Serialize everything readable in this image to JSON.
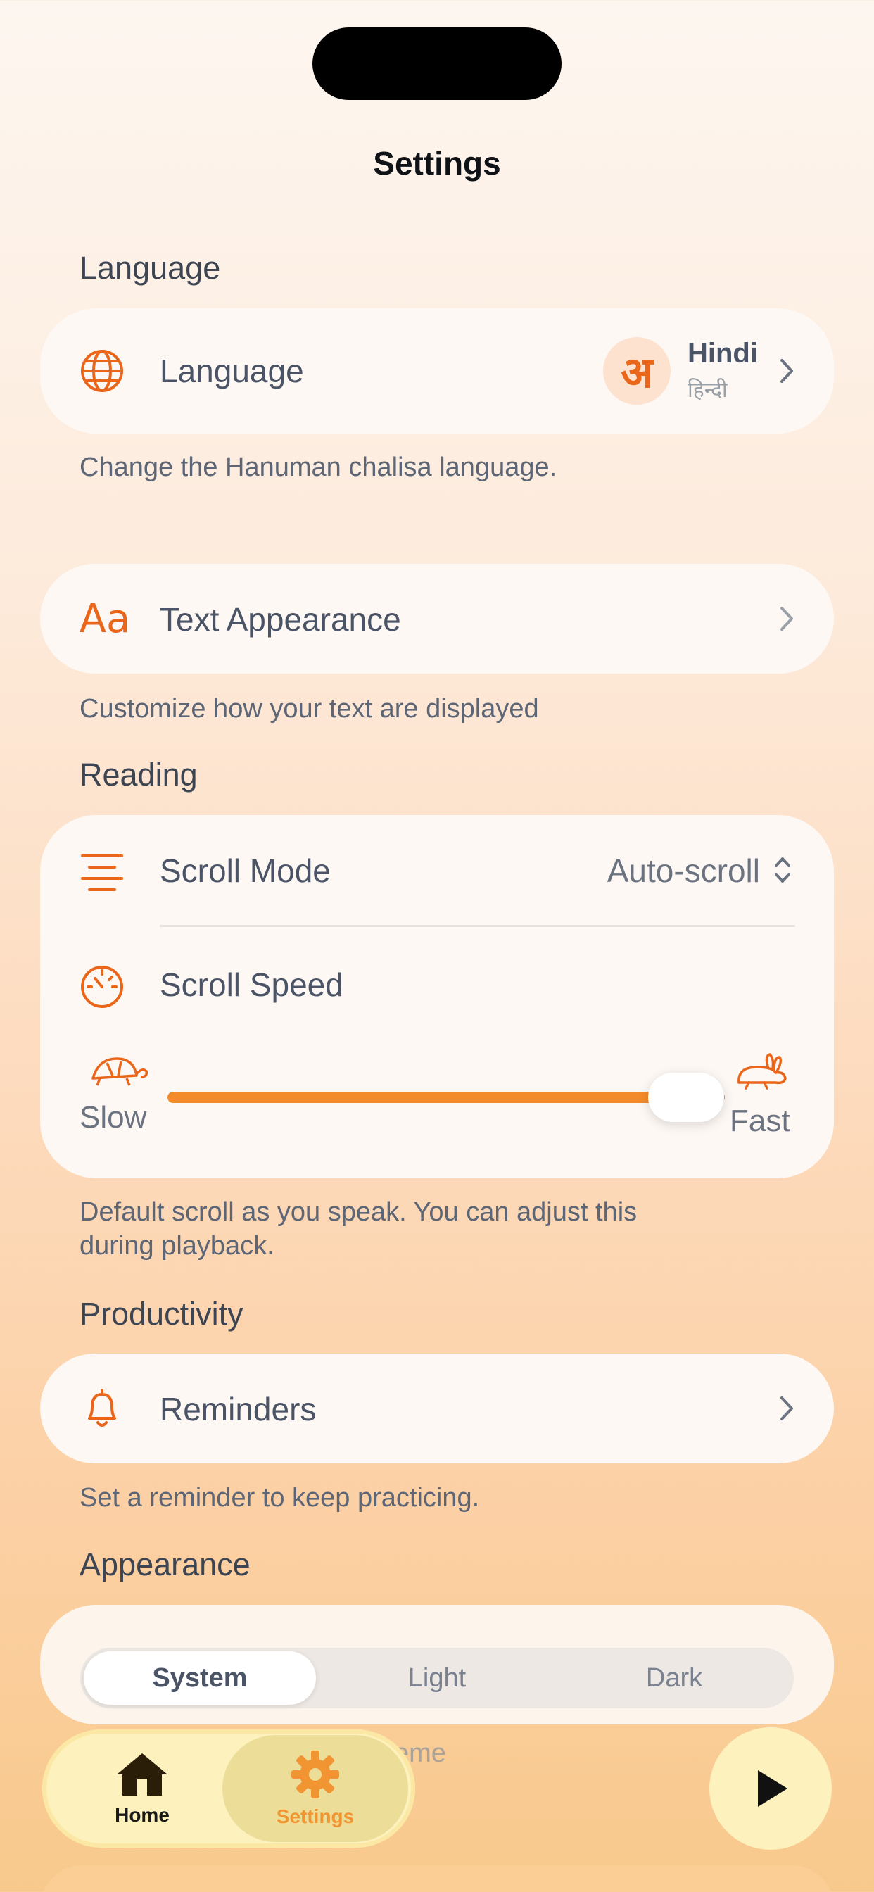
{
  "page": {
    "title": "Settings"
  },
  "language_section": {
    "heading": "Language",
    "row_label": "Language",
    "badge_glyph": "अ",
    "selected_language": "Hindi",
    "selected_native": "हिन्दी",
    "hint": "Change the Hanuman chalisa language."
  },
  "text_appearance": {
    "icon_text": "Aa",
    "row_label": "Text Appearance",
    "hint": "Customize how your text are displayed"
  },
  "reading_section": {
    "heading": "Reading",
    "scroll_mode_label": "Scroll Mode",
    "scroll_mode_value": "Auto-scroll",
    "scroll_speed_label": "Scroll Speed",
    "slow_label": "Slow",
    "fast_label": "Fast",
    "speed_value_fraction": 0.93,
    "hint_line1": "Default scroll as you speak. You can adjust this",
    "hint_line2": "during playback."
  },
  "productivity_section": {
    "heading": "Productivity",
    "reminders_label": "Reminders",
    "hint": "Set a reminder to keep practicing."
  },
  "appearance_section": {
    "heading": "Appearance",
    "options": [
      "System",
      "Light",
      "Dark"
    ],
    "selected": "System",
    "hint_partial": "eme"
  },
  "tabbar": {
    "home_label": "Home",
    "settings_label": "Settings",
    "active": "Settings"
  },
  "colors": {
    "accent": "#e9661a",
    "slider": "#f48b2b",
    "tabbar_bg": "#fdf1bd",
    "tab_active_bg": "#ecdd98",
    "settings_tab_text": "#f19533"
  },
  "icons": {
    "language": "globe-icon",
    "text_appearance": "text-aa-icon",
    "scroll_mode": "align-lines-icon",
    "scroll_speed": "speedometer-icon",
    "slow": "turtle-icon",
    "fast": "rabbit-icon",
    "reminders": "bell-icon",
    "home": "home-icon",
    "settings": "gear-icon",
    "play": "play-icon"
  }
}
